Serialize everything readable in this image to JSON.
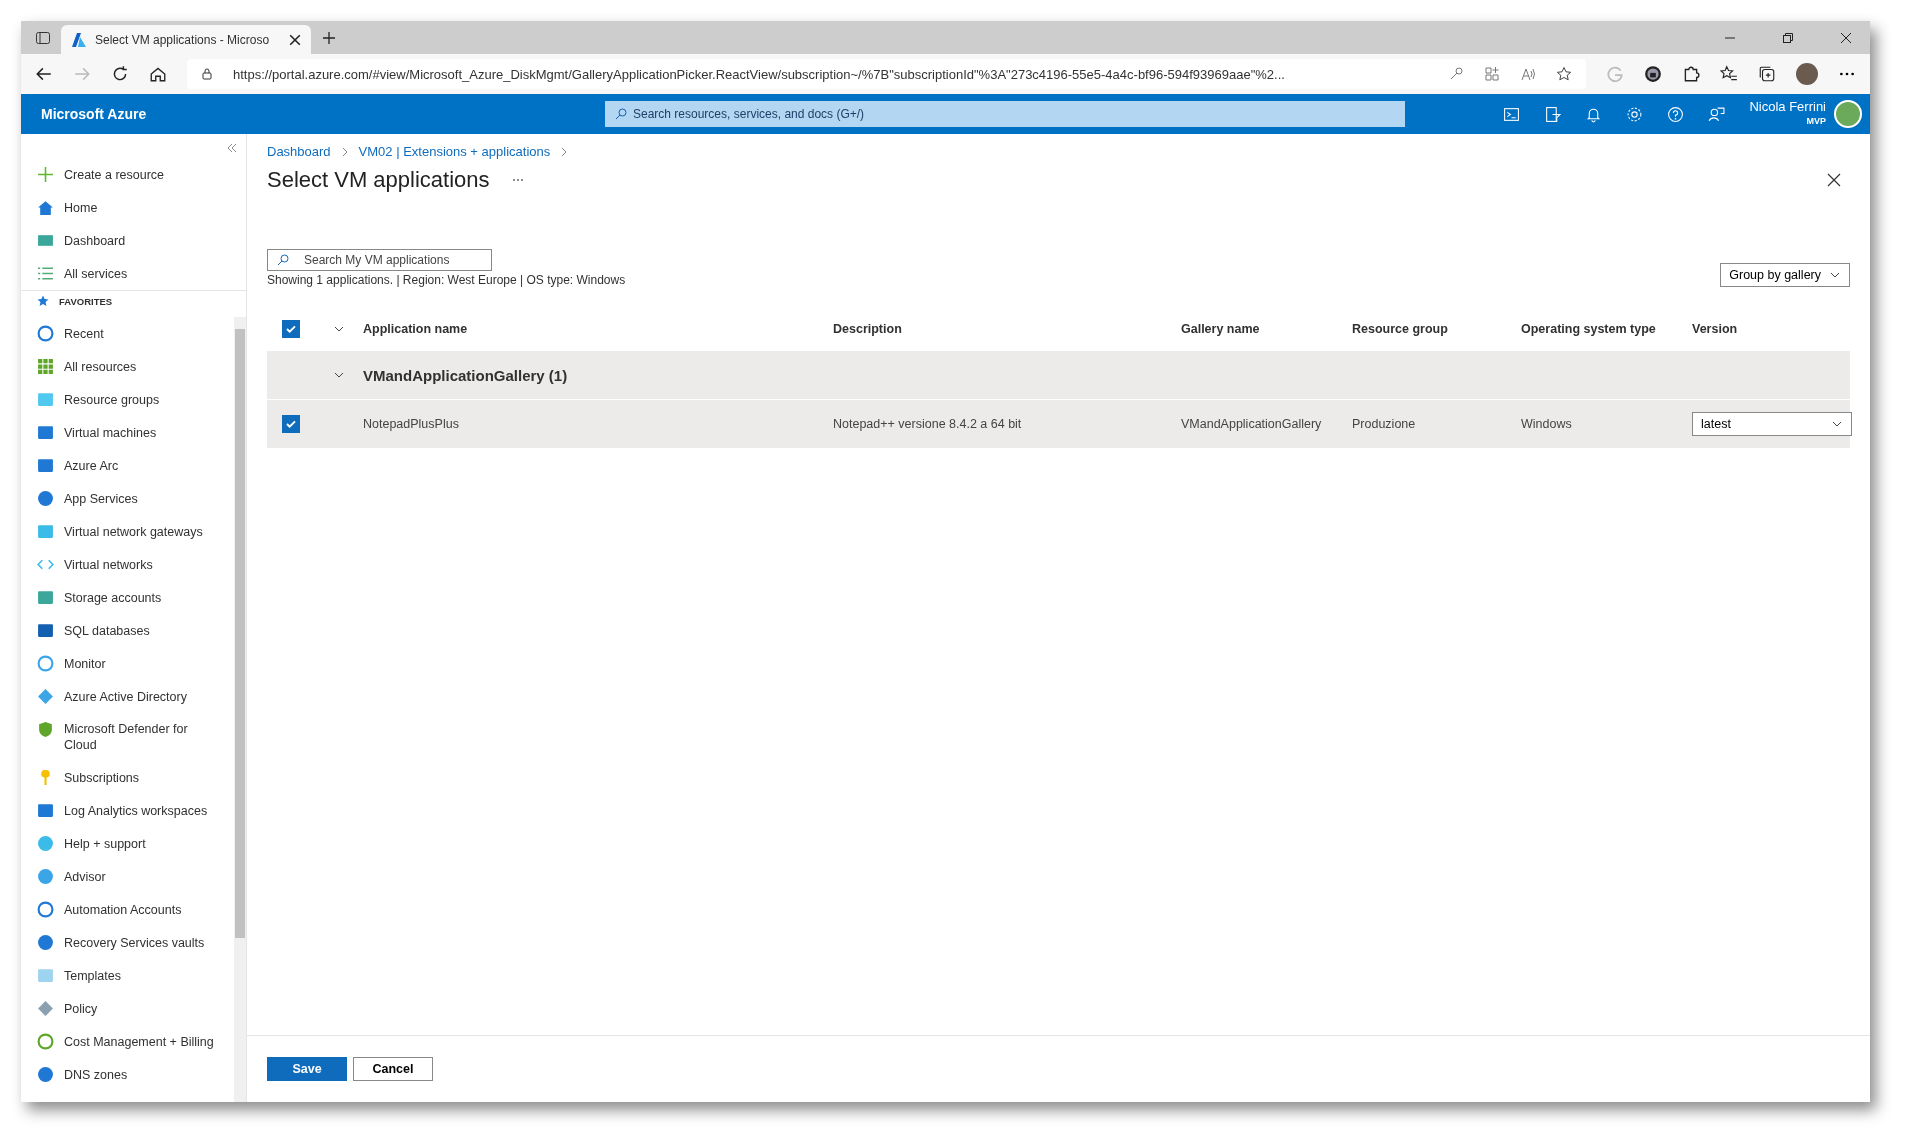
{
  "browser": {
    "tab_title": "Select VM applications - Microso",
    "url": "https://portal.azure.com/#view/Microsoft_Azure_DiskMgmt/GalleryApplicationPicker.ReactView/subscription~/%7B\"subscriptionId\"%3A\"273c4196-55e5-4a4c-bf96-594f93969aae\"%2..."
  },
  "portal": {
    "brand": "Microsoft Azure",
    "search": {
      "placeholder": "Search resources, services, and docs (G+/)"
    },
    "user": {
      "name": "Nicola Ferrini",
      "badge": "MVP"
    }
  },
  "sidebar": {
    "top_items": [
      "Create a resource",
      "Home",
      "Dashboard",
      "All services"
    ],
    "favorites_label": "FAVORITES",
    "favorites": [
      "Recent",
      "All resources",
      "Resource groups",
      "Virtual machines",
      "Azure Arc",
      "App Services",
      "Virtual network gateways",
      "Virtual networks",
      "Storage accounts",
      "SQL databases",
      "Monitor",
      "Azure Active Directory",
      "Microsoft Defender for Cloud",
      "Subscriptions",
      "Log Analytics workspaces",
      "Help + support",
      "Advisor",
      "Automation Accounts",
      "Recovery Services vaults",
      "Templates",
      "Policy",
      "Cost Management + Billing",
      "DNS zones"
    ]
  },
  "breadcrumb": [
    "Dashboard",
    "VM02 | Extensions + applications"
  ],
  "title": "Select VM applications",
  "search": {
    "placeholder": "Search My VM applications"
  },
  "summary": "Showing 1 applications. | Region: West Europe | OS type: Windows",
  "group_by": "Group by gallery",
  "table": {
    "all_checked": true,
    "columns": [
      "Application name",
      "Description",
      "Gallery name",
      "Resource group",
      "Operating system type",
      "Version"
    ],
    "groups": [
      {
        "name": "VMandApplicationGallery (1)",
        "expanded": true,
        "rows": [
          {
            "checked": true,
            "cells": [
              "NotepadPlusPlus",
              "Notepad++ versione 8.4.2 a 64 bit",
              "VMandApplicationGallery",
              "Produzione",
              "Windows"
            ],
            "version": "latest"
          }
        ]
      }
    ]
  },
  "buttons": [
    {
      "label": "Save",
      "kind": "primary"
    },
    {
      "label": "Cancel",
      "kind": "secondary"
    }
  ]
}
